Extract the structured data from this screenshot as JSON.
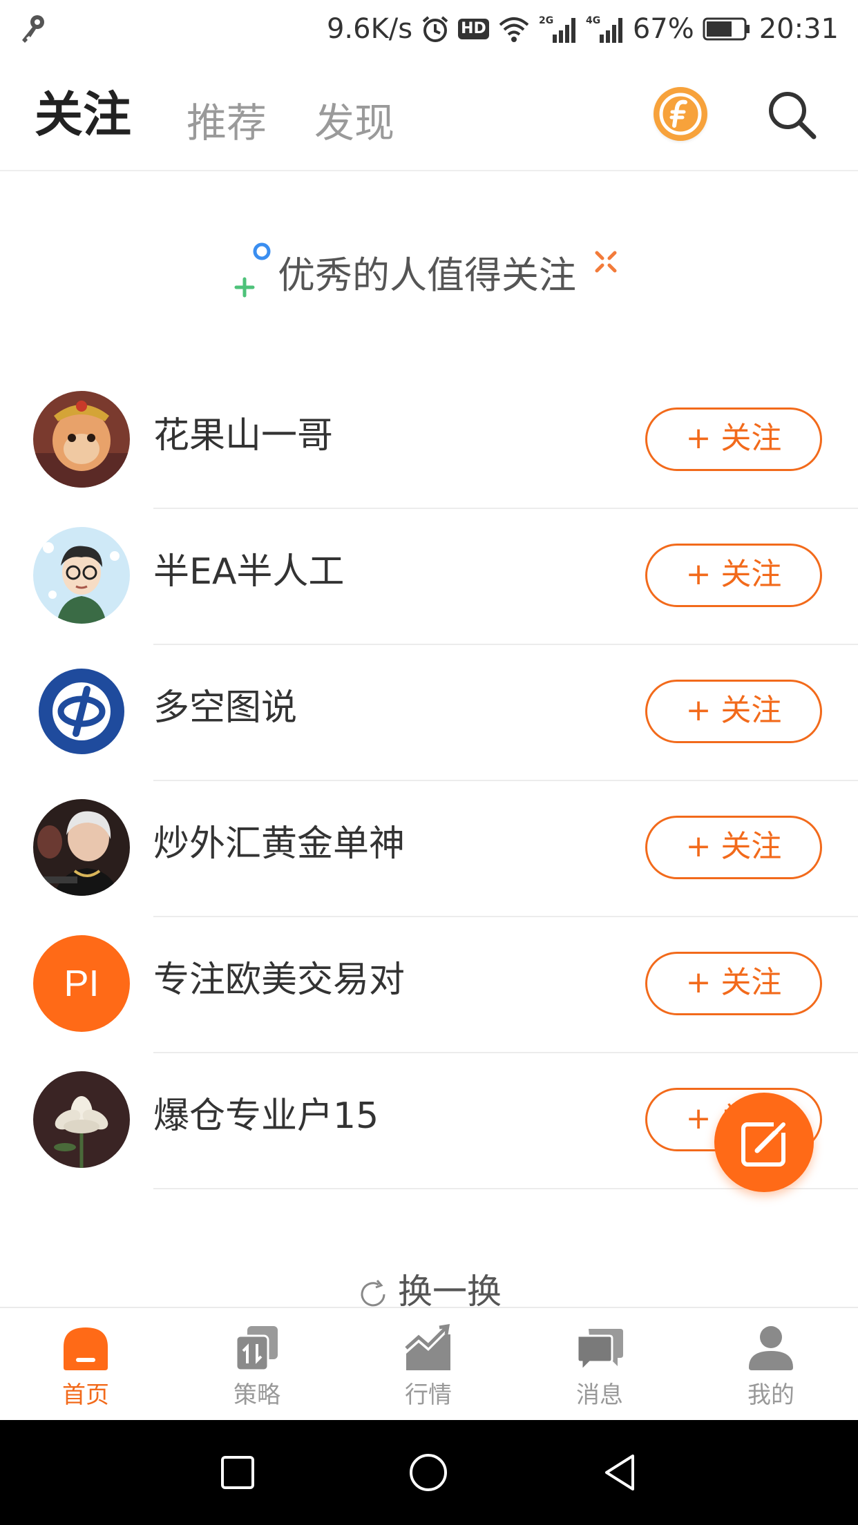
{
  "status_bar": {
    "net_speed": "9.6K/s",
    "hd": "HD",
    "sig_2g": "2G",
    "sig_4g": "4G",
    "battery": "67%",
    "time": "20:31"
  },
  "header": {
    "tabs": [
      "关注",
      "推荐",
      "发现"
    ],
    "active_tab": "关注"
  },
  "recommend": {
    "title": "优秀的人值得关注"
  },
  "users": [
    {
      "name": "花果山一哥",
      "follow_label": "+ 关注",
      "avatar": "monkey-king"
    },
    {
      "name": "半EA半人工",
      "follow_label": "+ 关注",
      "avatar": "cartoon-man"
    },
    {
      "name": "多空图说",
      "follow_label": "+ 关注",
      "avatar": "blue-logo"
    },
    {
      "name": "炒外汇黄金单神",
      "follow_label": "+ 关注",
      "avatar": "portrait-woman"
    },
    {
      "name": "专注欧美交易对",
      "follow_label": "+ 关注",
      "avatar_initials": "PI"
    },
    {
      "name": "爆仓专业户15",
      "follow_label": "+ 关注",
      "avatar": "white-flower"
    }
  ],
  "refresh_label": "换一换",
  "bottom_nav": [
    {
      "label": "首页",
      "icon": "home-icon",
      "active": true
    },
    {
      "label": "策略",
      "icon": "strategy-icon",
      "active": false
    },
    {
      "label": "行情",
      "icon": "chart-icon",
      "active": false
    },
    {
      "label": "消息",
      "icon": "message-icon",
      "active": false
    },
    {
      "label": "我的",
      "icon": "profile-icon",
      "active": false
    }
  ],
  "colors": {
    "accent": "#f26a1b",
    "coin": "#f7a23b",
    "muted": "#999999"
  }
}
